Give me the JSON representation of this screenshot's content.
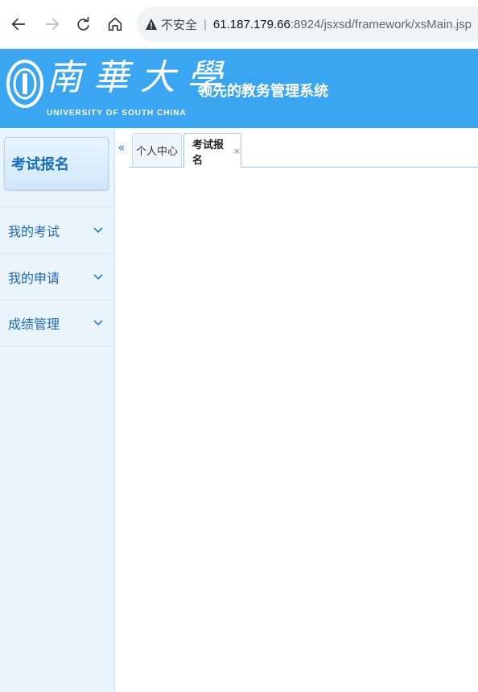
{
  "browser": {
    "security_label": "不安全",
    "separator": "|",
    "url_host": "61.187.179.66",
    "url_path": ":8924/jsxsd/framework/xsMain.jsp"
  },
  "header": {
    "university_cn": "南華大學",
    "university_en": "UNIVERSITY OF SOUTH CHINA",
    "system_title": "领先的教务管理系统",
    "banner_color": "#3aa5f0"
  },
  "sidebar": {
    "module_title": "考试报名",
    "items": [
      {
        "label": "我的考试",
        "icon": "chevron-down-icon"
      },
      {
        "label": "我的申请",
        "icon": "chevron-down-icon"
      },
      {
        "label": "成绩管理",
        "icon": "chevron-down-icon"
      }
    ]
  },
  "tabs": {
    "collapse_glyph": "«",
    "items": [
      {
        "label": "个人中心",
        "active": false
      },
      {
        "label": "考试报名",
        "active": true,
        "close": "×"
      }
    ]
  },
  "colors": {
    "accent": "#1f6bb3",
    "sidebar_bg": "#eaf4fc"
  }
}
